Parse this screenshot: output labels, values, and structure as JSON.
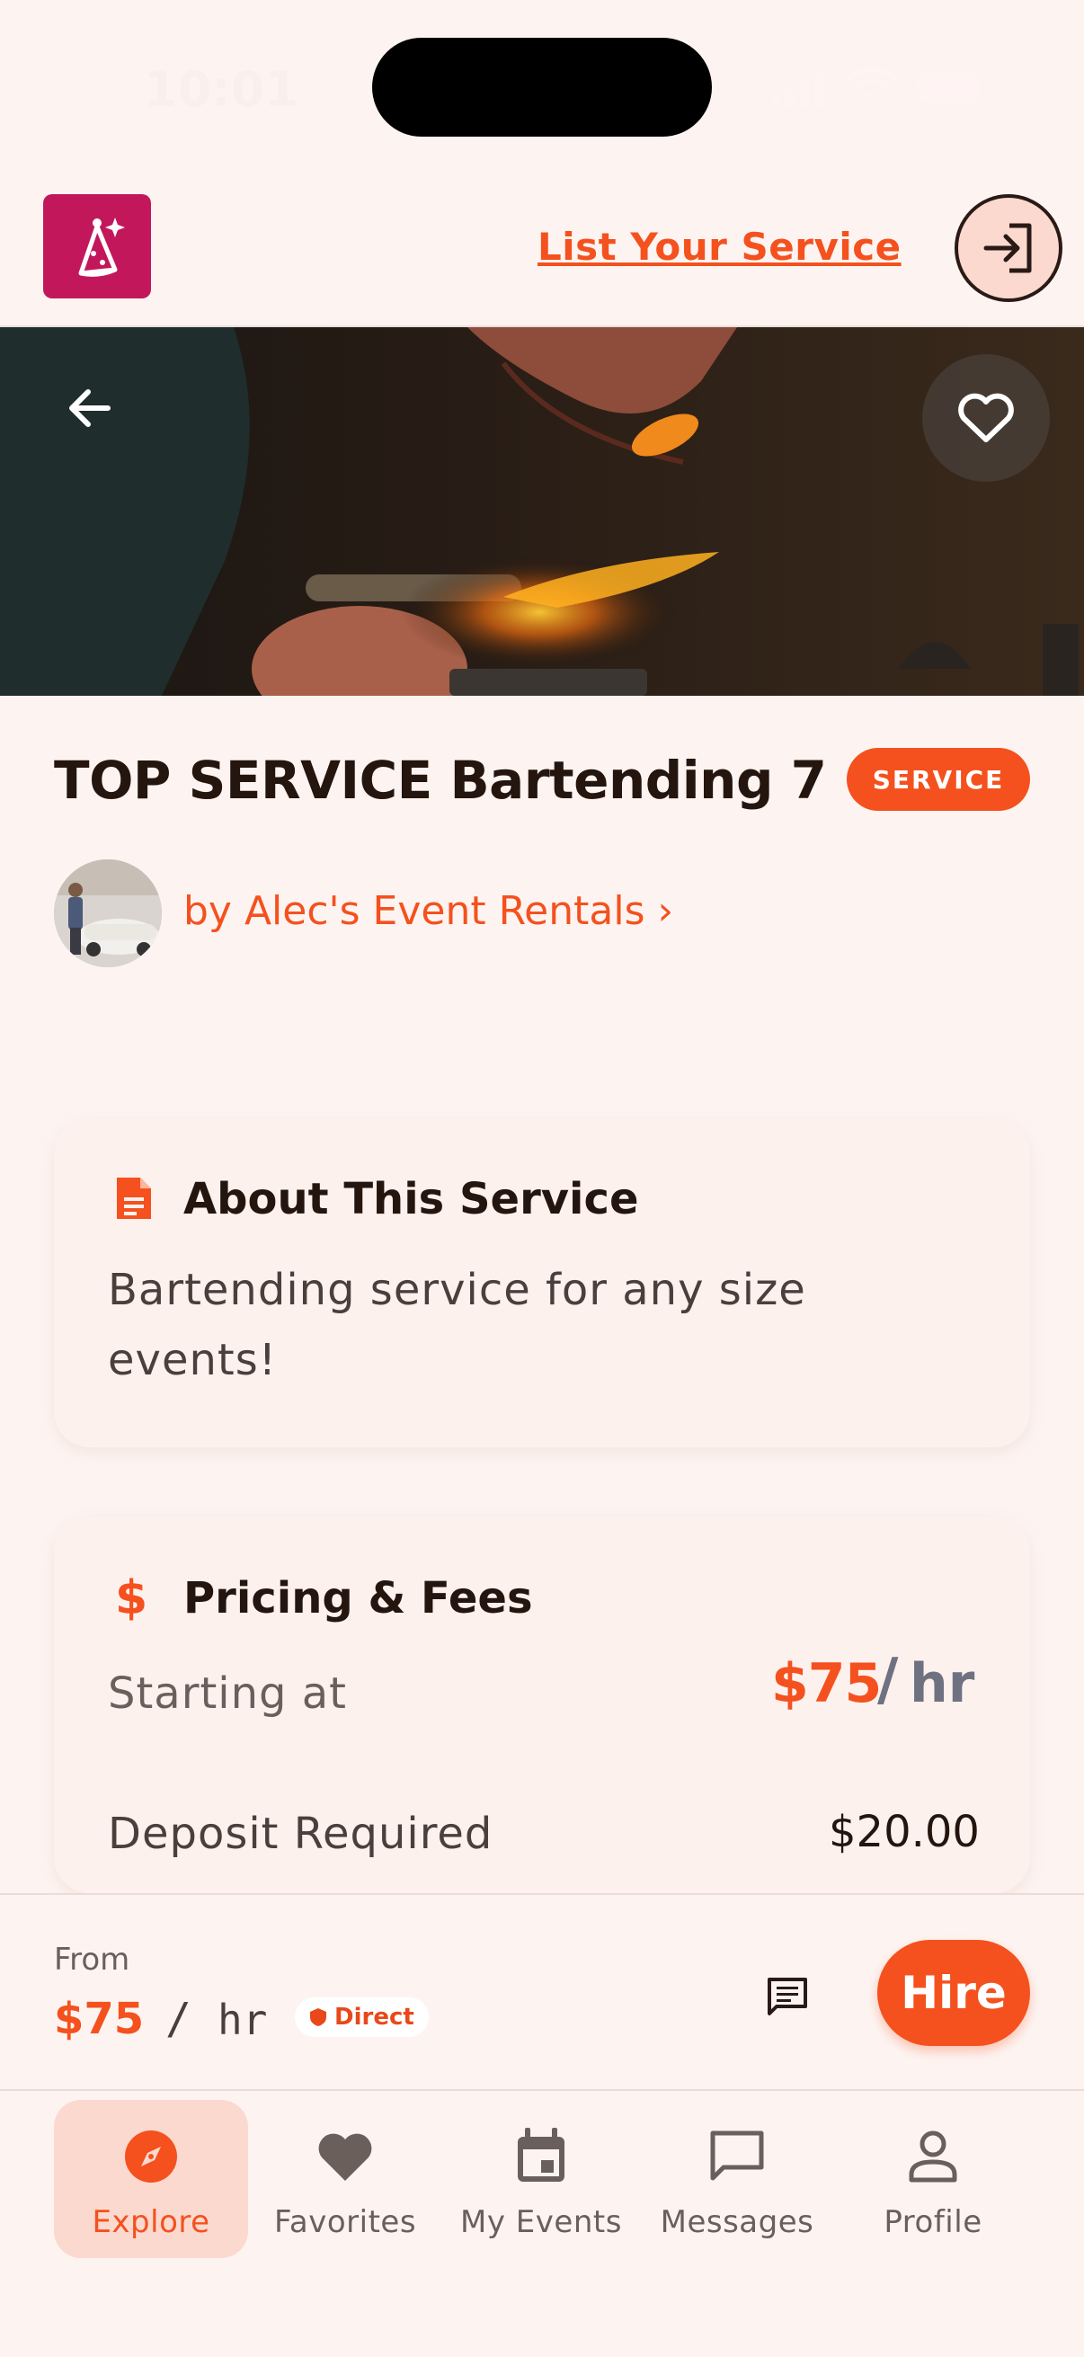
{
  "status_bar": {
    "time": "10:01"
  },
  "header": {
    "list_link": "List Your Service"
  },
  "service": {
    "title": "TOP SERVICE Bartending 7",
    "badge": "SERVICE",
    "provider": "by Alec's Event Rentals ›"
  },
  "about": {
    "title": "About This Service",
    "text": "Bartending service for any size events!"
  },
  "pricing": {
    "title": "Pricing & Fees",
    "starting_label": "Starting at",
    "starting_price": "$75",
    "slash": "/",
    "unit": "hr",
    "deposit_label": "Deposit Required",
    "deposit_value": "$20.00"
  },
  "action_bar": {
    "from_label": "From",
    "price": "$75",
    "slash": "/",
    "unit": "hr",
    "direct": "Direct",
    "hire": "Hire"
  },
  "tabs": [
    {
      "label": "Explore",
      "icon": "compass-icon",
      "active": true
    },
    {
      "label": "Favorites",
      "icon": "heart-icon",
      "active": false
    },
    {
      "label": "My Events",
      "icon": "calendar-icon",
      "active": false
    },
    {
      "label": "Messages",
      "icon": "chat-icon",
      "active": false
    },
    {
      "label": "Profile",
      "icon": "person-icon",
      "active": false
    }
  ],
  "colors": {
    "accent": "#f4511e",
    "logo_bg": "#c2185b",
    "background": "#fdf4f1",
    "card": "#fdf1ee"
  }
}
